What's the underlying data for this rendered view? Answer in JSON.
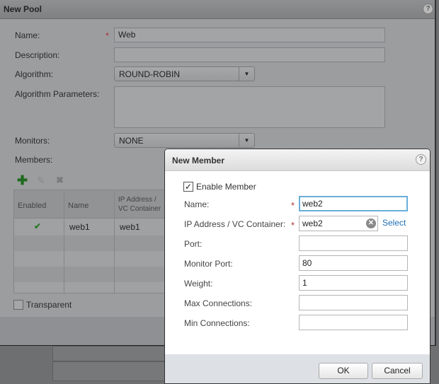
{
  "pool": {
    "title": "New Pool",
    "name_label": "Name:",
    "name_value": "Web",
    "description_label": "Description:",
    "description_value": "",
    "algorithm_label": "Algorithm:",
    "algorithm_value": "ROUND-ROBIN",
    "algorithm_params_label": "Algorithm Parameters:",
    "monitors_label": "Monitors:",
    "monitors_value": "NONE",
    "members_label": "Members:",
    "columns": [
      "Enabled",
      "Name",
      "IP Address / VC Container"
    ],
    "rows": [
      {
        "enabled": true,
        "name": "web1",
        "ip": "web1"
      }
    ],
    "transparent_label": "Transparent",
    "transparent_checked": false
  },
  "member": {
    "title": "New Member",
    "enable_label": "Enable Member",
    "enable_checked": true,
    "name_label": "Name:",
    "name_value": "web2",
    "ip_label": "IP Address / VC Container:",
    "ip_value": "web2",
    "select_link": "Select",
    "port_label": "Port:",
    "port_value": "",
    "monitor_port_label": "Monitor Port:",
    "monitor_port_value": "80",
    "weight_label": "Weight:",
    "weight_value": "1",
    "max_conn_label": "Max Connections:",
    "max_conn_value": "",
    "min_conn_label": "Min Connections:",
    "min_conn_value": "",
    "ok": "OK",
    "cancel": "Cancel"
  },
  "help": "?",
  "required_mark": "*",
  "colors": {
    "accent_link": "#1f6fb5",
    "required": "#cc3333",
    "focus": "#5aa0d0"
  }
}
